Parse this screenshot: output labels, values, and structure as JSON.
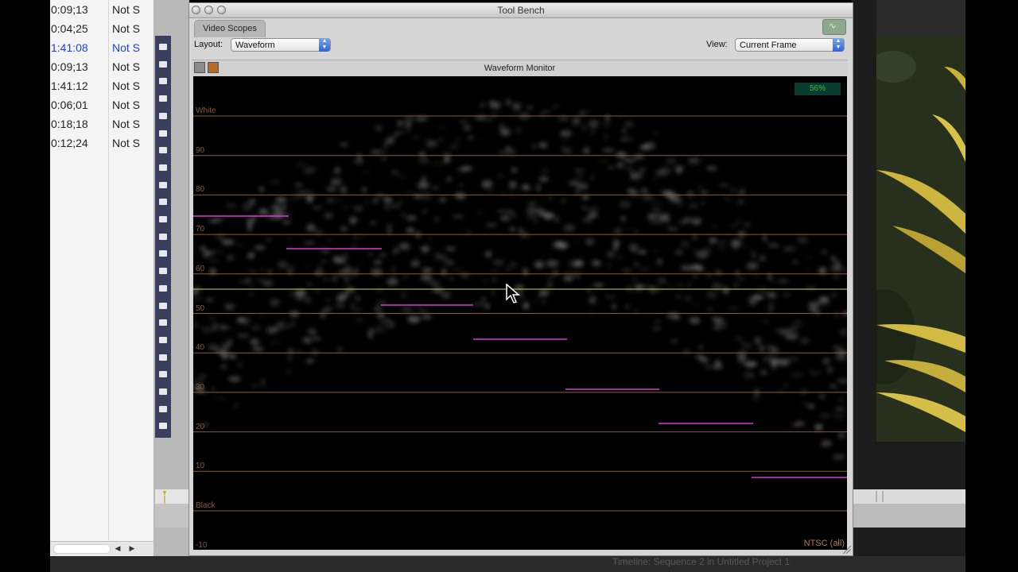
{
  "browser": {
    "rows": [
      {
        "duration": "0:09;13",
        "status": "Not S"
      },
      {
        "duration": "0:04;25",
        "status": "Not S"
      },
      {
        "duration": "1:41:08",
        "status": "Not S",
        "selected": true
      },
      {
        "duration": "0:09;13",
        "status": "Not S"
      },
      {
        "duration": "1:41:12",
        "status": "Not S"
      },
      {
        "duration": "0:06;01",
        "status": "Not S"
      },
      {
        "duration": "0:18;18",
        "status": "Not S"
      },
      {
        "duration": "0:12;24",
        "status": "Not S"
      }
    ],
    "scroll_left": "◀",
    "scroll_right": "▶"
  },
  "toolbench": {
    "title": "Tool Bench",
    "tab": "Video Scopes",
    "layout_label": "Layout:",
    "layout_value": "Waveform",
    "view_label": "View:",
    "view_value": "Current Frame",
    "scope_title": "Waveform Monitor",
    "percent": "56%",
    "standard": "NTSC (all)",
    "scale_labels": [
      "White",
      "90",
      "80",
      "70",
      "60",
      "50",
      "40",
      "30",
      "20",
      "10",
      "Black",
      "-10"
    ]
  },
  "timeline_status": "Timeline: Sequence 2 in Untitled Project 1",
  "colors": {
    "grid": "#8a5a3a",
    "highlight": "#c8d24a",
    "magenta": "#d23cd2",
    "selected_text": "#1a3fe0"
  }
}
